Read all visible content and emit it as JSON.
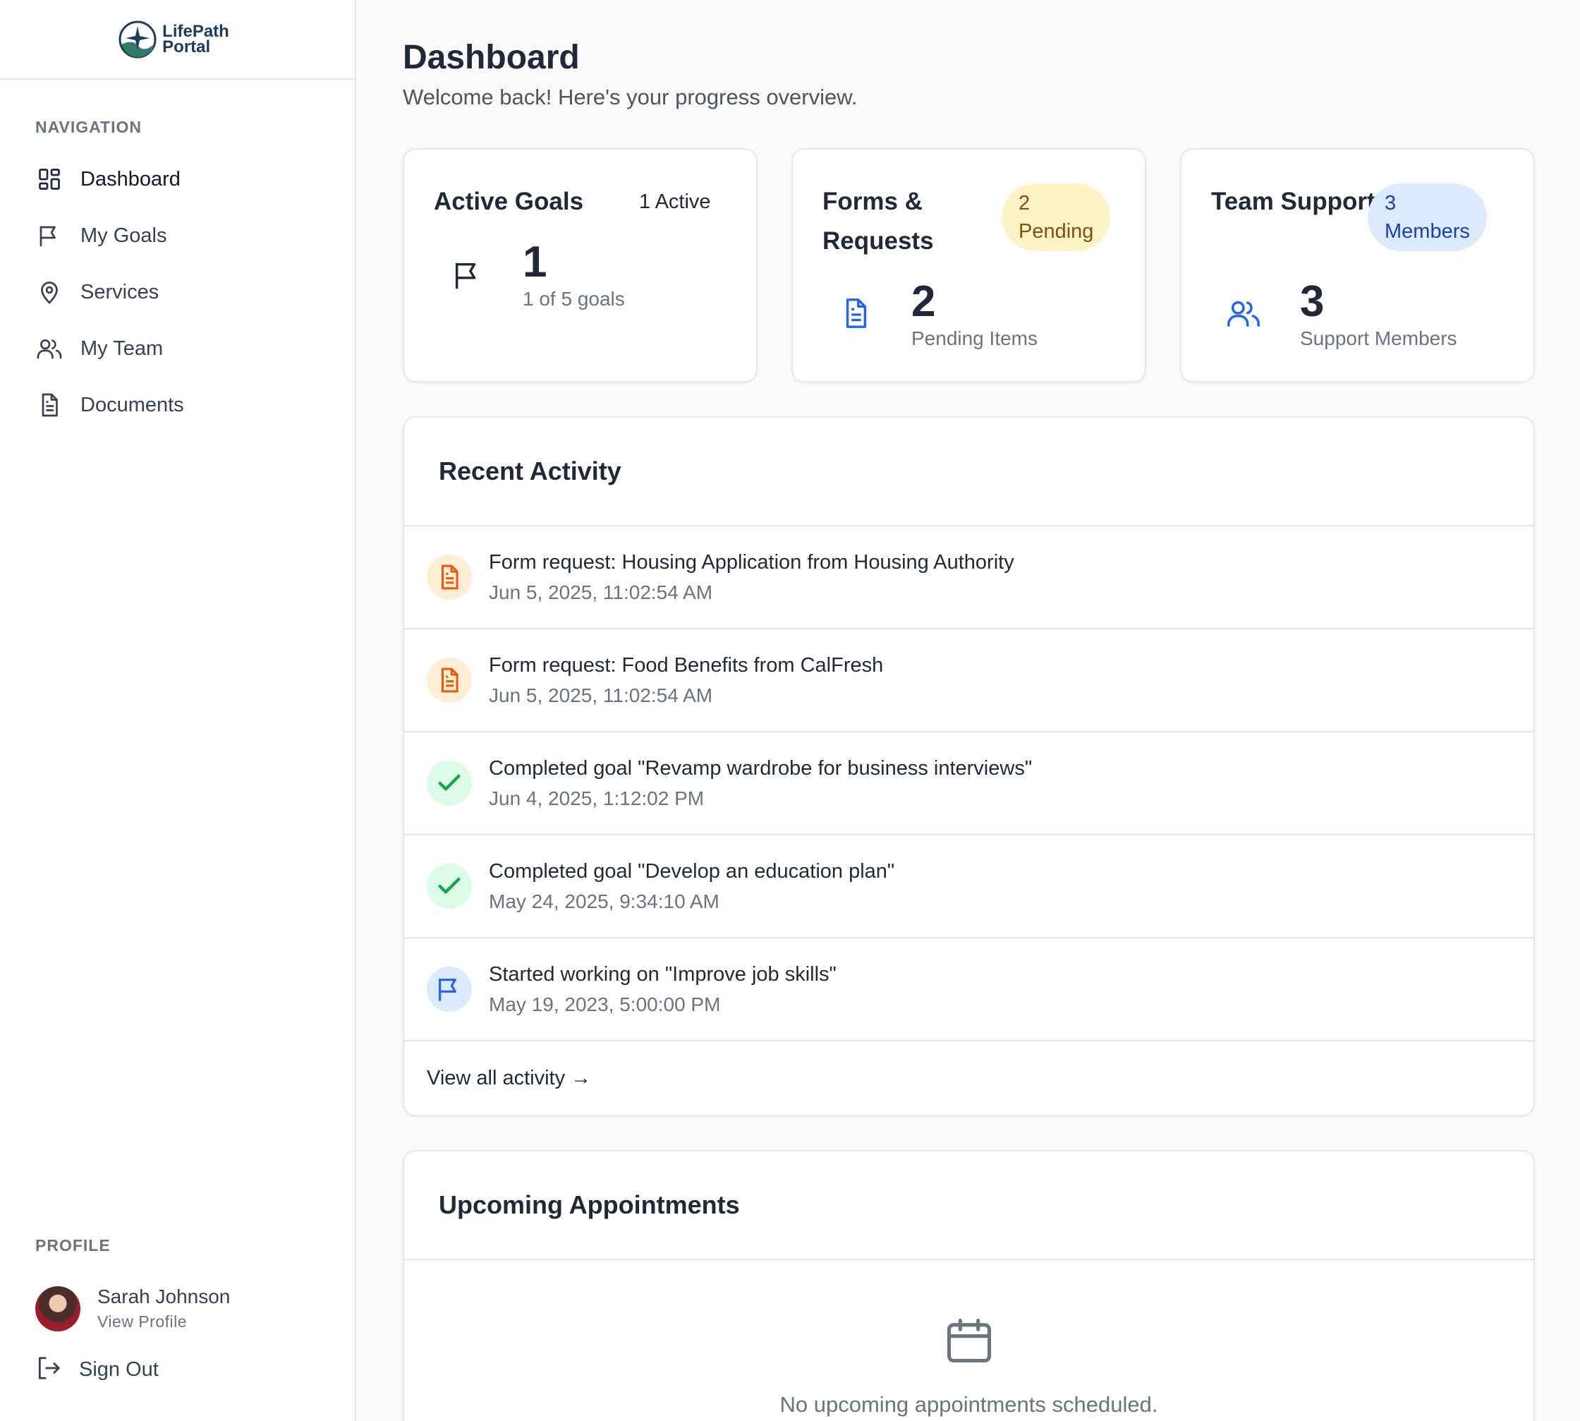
{
  "brand": {
    "line1": "LifePath",
    "line2": "Portal"
  },
  "sidebar": {
    "nav_label": "NAVIGATION",
    "items": [
      {
        "label": "Dashboard",
        "icon": "dashboard-grid-icon"
      },
      {
        "label": "My Goals",
        "icon": "flag-icon"
      },
      {
        "label": "Services",
        "icon": "map-pin-icon"
      },
      {
        "label": "My Team",
        "icon": "users-icon"
      },
      {
        "label": "Documents",
        "icon": "document-icon"
      }
    ],
    "profile_label": "PROFILE",
    "profile": {
      "name": "Sarah Johnson",
      "link": "View Profile"
    },
    "signout": "Sign Out"
  },
  "header": {
    "title": "Dashboard",
    "subtitle": "Welcome back! Here's your progress overview."
  },
  "stats": {
    "goals": {
      "title": "Active Goals",
      "badge": "1 Active",
      "value": "1",
      "caption": "1 of 5 goals",
      "icon": "flag-icon"
    },
    "forms": {
      "title": "Forms & Requests",
      "badge_count": "2",
      "badge_text": "Pending",
      "value": "2",
      "caption": "Pending Items",
      "icon": "document-icon",
      "badge_bg": "#fef3c7",
      "badge_color": "#854d0e"
    },
    "team": {
      "title": "Team Support",
      "badge_count": "3",
      "badge_text": "Members",
      "value": "3",
      "caption": "Support Members",
      "icon": "users-icon",
      "badge_bg": "#dbeafe",
      "badge_color": "#1e40af"
    }
  },
  "activity": {
    "title": "Recent Activity",
    "items": [
      {
        "text": "Form request: Housing Application from Housing Authority",
        "time": "Jun 5, 2025, 11:02:54 AM",
        "icon": "document-icon"
      },
      {
        "text": "Form request: Food Benefits from CalFresh",
        "time": "Jun 5, 2025, 11:02:54 AM",
        "icon": "document-icon"
      },
      {
        "text": "Completed goal \"Revamp wardrobe for business interviews\"",
        "time": "Jun 4, 2025, 1:12:02 PM",
        "icon": "check-icon"
      },
      {
        "text": "Completed goal \"Develop an education plan\"",
        "time": "May 24, 2025, 9:34:10 AM",
        "icon": "check-icon"
      },
      {
        "text": "Started working on \"Improve job skills\"",
        "time": "May 19, 2023, 5:00:00 PM",
        "icon": "flag-icon"
      }
    ],
    "view_all": "View all activity →"
  },
  "appointments": {
    "title": "Upcoming Appointments",
    "empty": "No upcoming appointments scheduled.",
    "icon": "calendar-icon"
  },
  "colors": {
    "orange": "#ea580c",
    "orange_bg": "#ffedd5",
    "green": "#16a34a",
    "green_bg": "#dcfce7",
    "blue": "#2563eb",
    "blue_bg": "#dbeafe"
  }
}
